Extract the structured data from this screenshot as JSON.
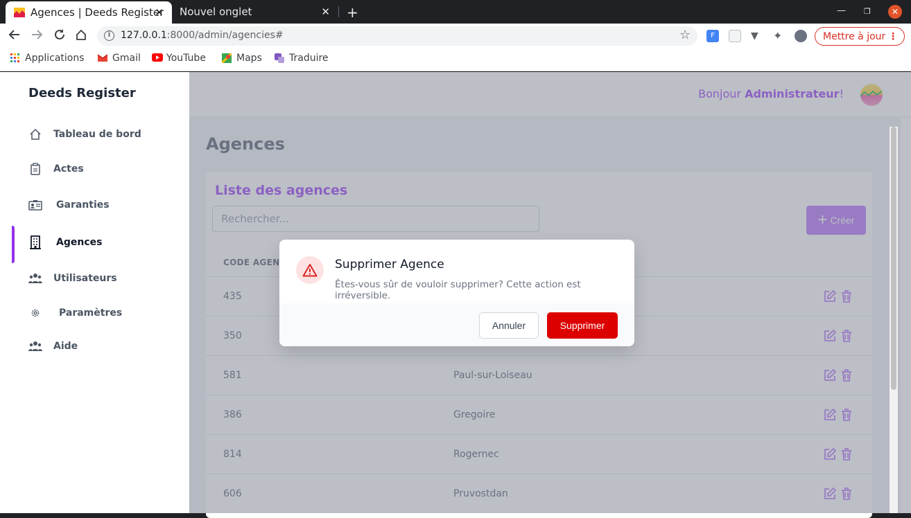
{
  "browser": {
    "tabs": [
      {
        "title": "Agences | Deeds Register",
        "active": true
      },
      {
        "title": "Nouvel onglet",
        "active": false
      }
    ],
    "url_host": "127.0.0.1",
    "url_rest": ":8000/admin/agencies#",
    "update_label": "Mettre à jour",
    "bookmarks": [
      {
        "label": "Applications",
        "icon": "apps-grid-icon"
      },
      {
        "label": "Gmail",
        "icon": "gmail-icon"
      },
      {
        "label": "YouTube",
        "icon": "youtube-icon"
      },
      {
        "label": "Maps",
        "icon": "maps-icon"
      },
      {
        "label": "Traduire",
        "icon": "translate-icon"
      }
    ]
  },
  "sidebar": {
    "brand": "Deeds Register",
    "items": [
      {
        "label": "Tableau de bord",
        "icon": "home-icon"
      },
      {
        "label": "Actes",
        "icon": "clipboard-icon"
      },
      {
        "label": "Garanties",
        "icon": "id-card-icon"
      },
      {
        "label": "Agences",
        "icon": "building-icon",
        "active": true
      },
      {
        "label": "Utilisateurs",
        "icon": "users-icon"
      },
      {
        "label": "Paramètres",
        "icon": "gear-icon"
      },
      {
        "label": "Aide",
        "icon": "users-icon"
      }
    ]
  },
  "header": {
    "greeting_prefix": "Bonjour ",
    "greeting_name": "Administrateur",
    "greeting_suffix": "!"
  },
  "main": {
    "title": "Agences",
    "card_title": "Liste des agences",
    "search_placeholder": "Rechercher...",
    "create_label": "Créer",
    "column_code": "CODE AGENC",
    "rows": [
      {
        "code": "435",
        "name": ""
      },
      {
        "code": "350",
        "name": ""
      },
      {
        "code": "581",
        "name": "Paul-sur-Loiseau"
      },
      {
        "code": "386",
        "name": "Gregoire"
      },
      {
        "code": "814",
        "name": "Rogernec"
      },
      {
        "code": "606",
        "name": "Pruvostdan"
      }
    ]
  },
  "modal": {
    "title": "Supprimer Agence",
    "text": "Êtes-vous sûr de vouloir supprimer? Cette action est irréversible.",
    "cancel_label": "Annuler",
    "delete_label": "Supprimer"
  },
  "colors": {
    "accent": "#a855f7",
    "danger": "#dc0000",
    "active_bar": "#9333ea"
  }
}
